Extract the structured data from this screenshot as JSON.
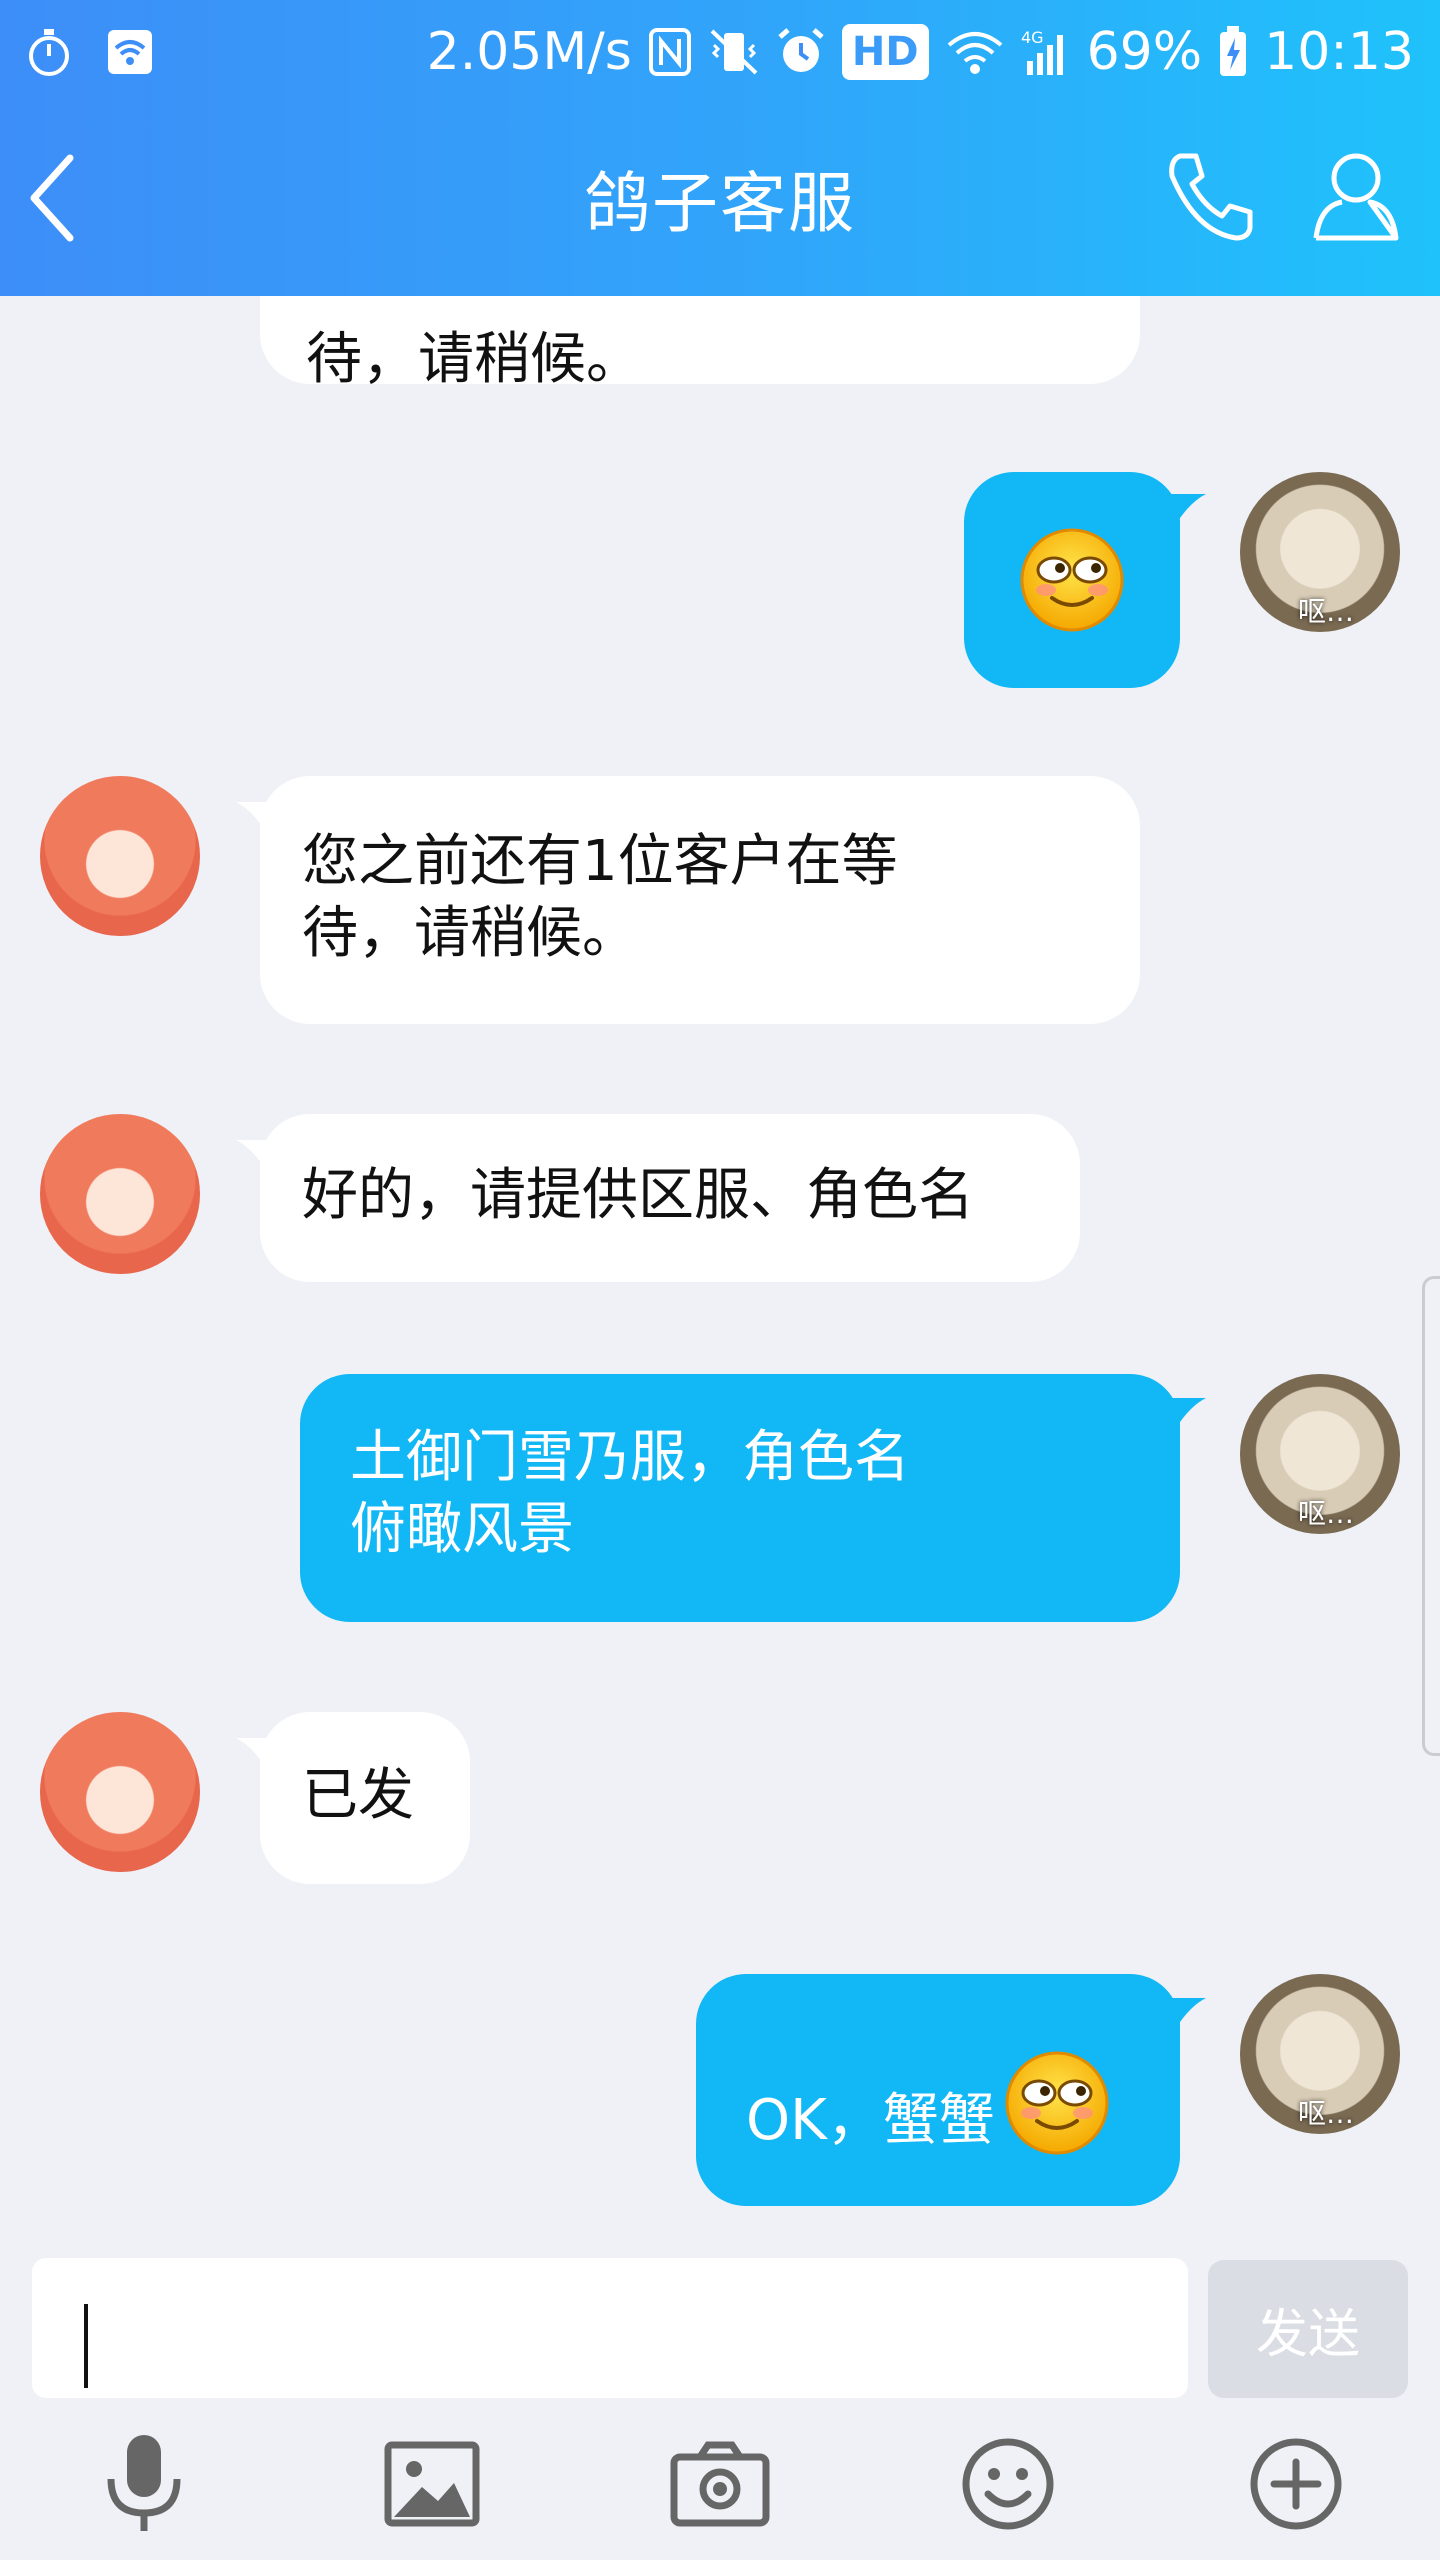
{
  "statusbar": {
    "speed": "2.05M/s",
    "hd": "HD",
    "network": "4G",
    "battery": "69%",
    "time": "10:13"
  },
  "header": {
    "title": "鸽子客服"
  },
  "messages": [
    {
      "side": "in",
      "text_line1": "待，请稍候。"
    },
    {
      "side": "out",
      "emoji": "smug-emoji"
    },
    {
      "side": "in",
      "text_line1": "您之前还有1位客户在等",
      "text_line2": "待，请稍候。"
    },
    {
      "side": "in",
      "text_line1": "好的，请提供区服、角色名"
    },
    {
      "side": "out",
      "text_line1": "土御门雪乃服，角色名",
      "text_line2": "俯瞰风景"
    },
    {
      "side": "in",
      "text_line1": "已发"
    },
    {
      "side": "out",
      "text_line1": "OK，蟹蟹",
      "emoji": "smug-emoji"
    }
  ],
  "user_avatar_label": "呕…",
  "input": {
    "value": "",
    "send_label": "发送"
  },
  "toolbar": {
    "items": [
      "microphone-icon",
      "image-icon",
      "camera-icon",
      "emoji-icon",
      "plus-icon"
    ]
  },
  "colors": {
    "header_start": "#3d8ef8",
    "header_end": "#1fc2fb",
    "out_bubble": "#12b7f5",
    "in_bubble": "#ffffff",
    "background": "#eff1f6"
  }
}
